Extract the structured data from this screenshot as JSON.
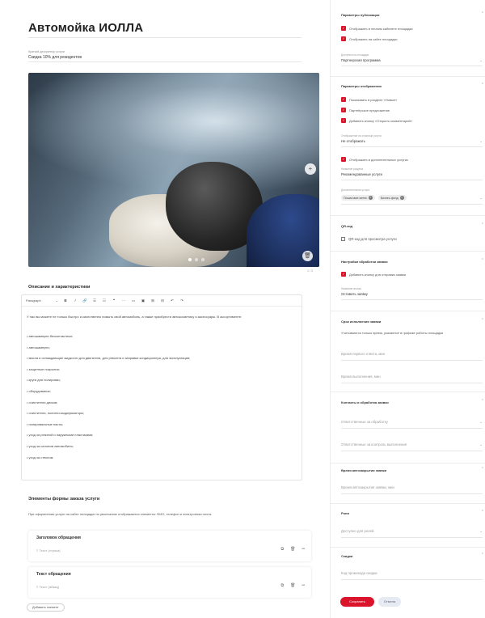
{
  "main": {
    "title": "Автомойка ИОЛЛА",
    "short_desc_label": "Краткий дескриптор услуги",
    "short_desc_value": "Скидка 10% для резидентов",
    "gallery_counter": "1 / 3",
    "description_title": "Описание и характеристики",
    "editor": {
      "format_select": "Paragraph",
      "toolbar_buttons": [
        "B",
        "I",
        "🔗",
        "☰",
        "☷",
        "❝",
        "⋯",
        "▭",
        "▣",
        "⊞",
        "⊟",
        "↶",
        "↷"
      ],
      "intro": "У нас вы можете не только быстро и качественно помыть свой автомобиль, а также приобрести автокосметику и аксессуары. В ассортименте:",
      "bullets": [
        "• автошампуни бесконтактные;",
        "• автошампуни;",
        "• масла и охлаждающие жидкости для двигателя, для ремонта и заправки кондиционера, для эксплуатации;",
        "• защитные покрытия;",
        "• круги для полировки;",
        "• оборудование;",
        "• очистители дисков;",
        "• очистители, полиэти-модификаторы;",
        "• полировальные пасты;",
        "• уход за резиной и наружными пластиками;",
        "• уход за салоном автомобиля;",
        "• уход за стеклом."
      ]
    },
    "form": {
      "title": "Элементы формы заказа услуги",
      "description": "При оформлении услуги на сайте площадки по умолчанию отображаются элементы: ФИО, телефон и электронная почта.",
      "cards": [
        {
          "title": "Заголовок обращения",
          "type": "Текст (строка)"
        },
        {
          "title": "Текст обращения",
          "type": "Текст (абзац)"
        }
      ],
      "add_button": "Добавить элемент"
    }
  },
  "sidebar": {
    "publication": {
      "title": "Параметры публикации",
      "checks": [
        "Отображать в личном кабинете площадки",
        "Отображать на сайте площадки"
      ],
      "field_label": "Доступность площадки",
      "field_value": "Партнерская программа"
    },
    "display": {
      "title": "Параметры отображения",
      "checks": [
        "Показывать в разделе «Новые»",
        "Партнёрское предложение",
        "Добавить кнопку «Открыть комментарий»"
      ],
      "field_label": "Отображение на странице услуги",
      "field_value": "Не отображать",
      "check2": "Отображать в дополнительных услугах",
      "field2_label": "Название раздела",
      "field2_value": "Рекомендованные услуги",
      "tags_label": "Дополнительная услуга",
      "tags": [
        "Пошаговое меню",
        "Бизнес-фонд"
      ]
    },
    "qr": {
      "title": "QR-код",
      "action": "QR-код для просмотра услуги"
    },
    "requests": {
      "title": "Настройки обработки заявки",
      "check": "Добавить кнопку для отправки заявки",
      "field_label": "Название кнопки",
      "field_value": "Оставить заявку"
    },
    "deadline": {
      "title": "Срок исполнения заявки",
      "text": "Учитываются только время, указанное в графике работы площадки",
      "field1": "Время первого ответа, мин",
      "field2": "Время выполнения, мин"
    },
    "contacts": {
      "title": "Контакты и обработка заявки",
      "field1": "Ответственные за обработку",
      "field2": "Ответственные за контроль выполнения"
    },
    "autoclose": {
      "title": "Время автозакрытия заявки",
      "field": "Время автозакрытия заявки, мин"
    },
    "roles": {
      "title": "Роли",
      "field": "Доступно для ролей"
    },
    "promo": {
      "title": "Скидки",
      "field": "Код промокода скидки"
    },
    "buttons": {
      "save": "Сохранить",
      "cancel": "Отмена"
    }
  },
  "colors": {
    "accent_red": "#d9142b",
    "cancel_bg": "#e6eaf2"
  }
}
